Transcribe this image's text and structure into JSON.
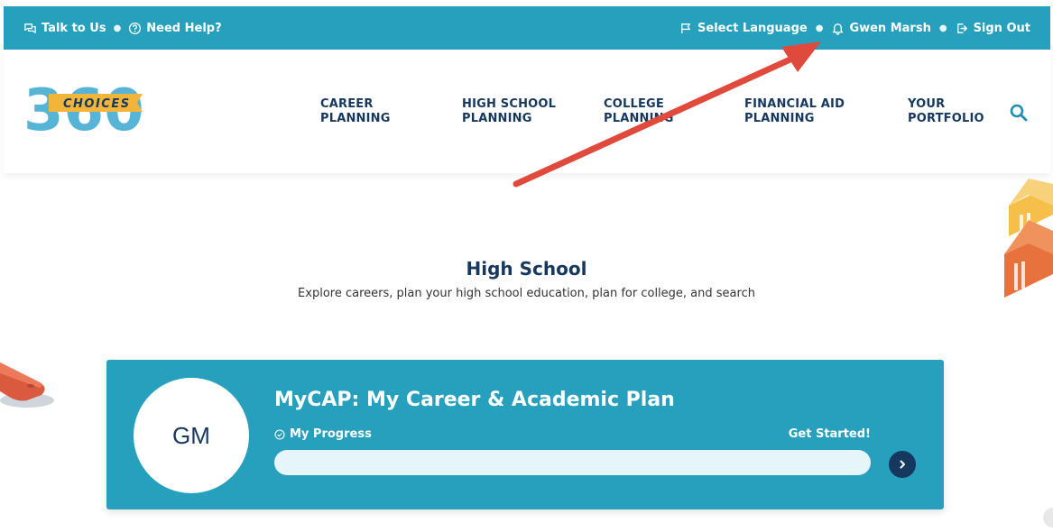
{
  "topbar": {
    "talk": "Talk to Us",
    "help": "Need Help?",
    "language": "Select Language",
    "user": "Gwen Marsh",
    "signout": "Sign Out"
  },
  "logo": {
    "number": "360",
    "text": "CHOICES"
  },
  "nav": [
    {
      "label": "CAREER\nPLANNING"
    },
    {
      "label": "HIGH SCHOOL\nPLANNING"
    },
    {
      "label": "COLLEGE\nPLANNING"
    },
    {
      "label": "FINANCIAL AID\nPLANNING"
    },
    {
      "label": "YOUR\nPORTFOLIO"
    }
  ],
  "hero": {
    "title": "High School",
    "subtitle": "Explore careers, plan your high school education, plan for college, and search"
  },
  "mycap": {
    "initials": "GM",
    "title": "MyCAP: My Career & Academic Plan",
    "progress_label": "My Progress",
    "cta": "Get Started!",
    "progress_percent": 0
  },
  "colors": {
    "brand_teal": "#27a0bd",
    "navy": "#16385e",
    "arrow_red": "#e04a3c",
    "orange": "#e8723e",
    "yellow": "#f2b53a"
  },
  "icons": [
    "chat-icon",
    "help-icon",
    "flag-icon",
    "bell-icon",
    "sign-out-icon",
    "search-icon",
    "check-circle-icon",
    "chevron-right-icon"
  ]
}
